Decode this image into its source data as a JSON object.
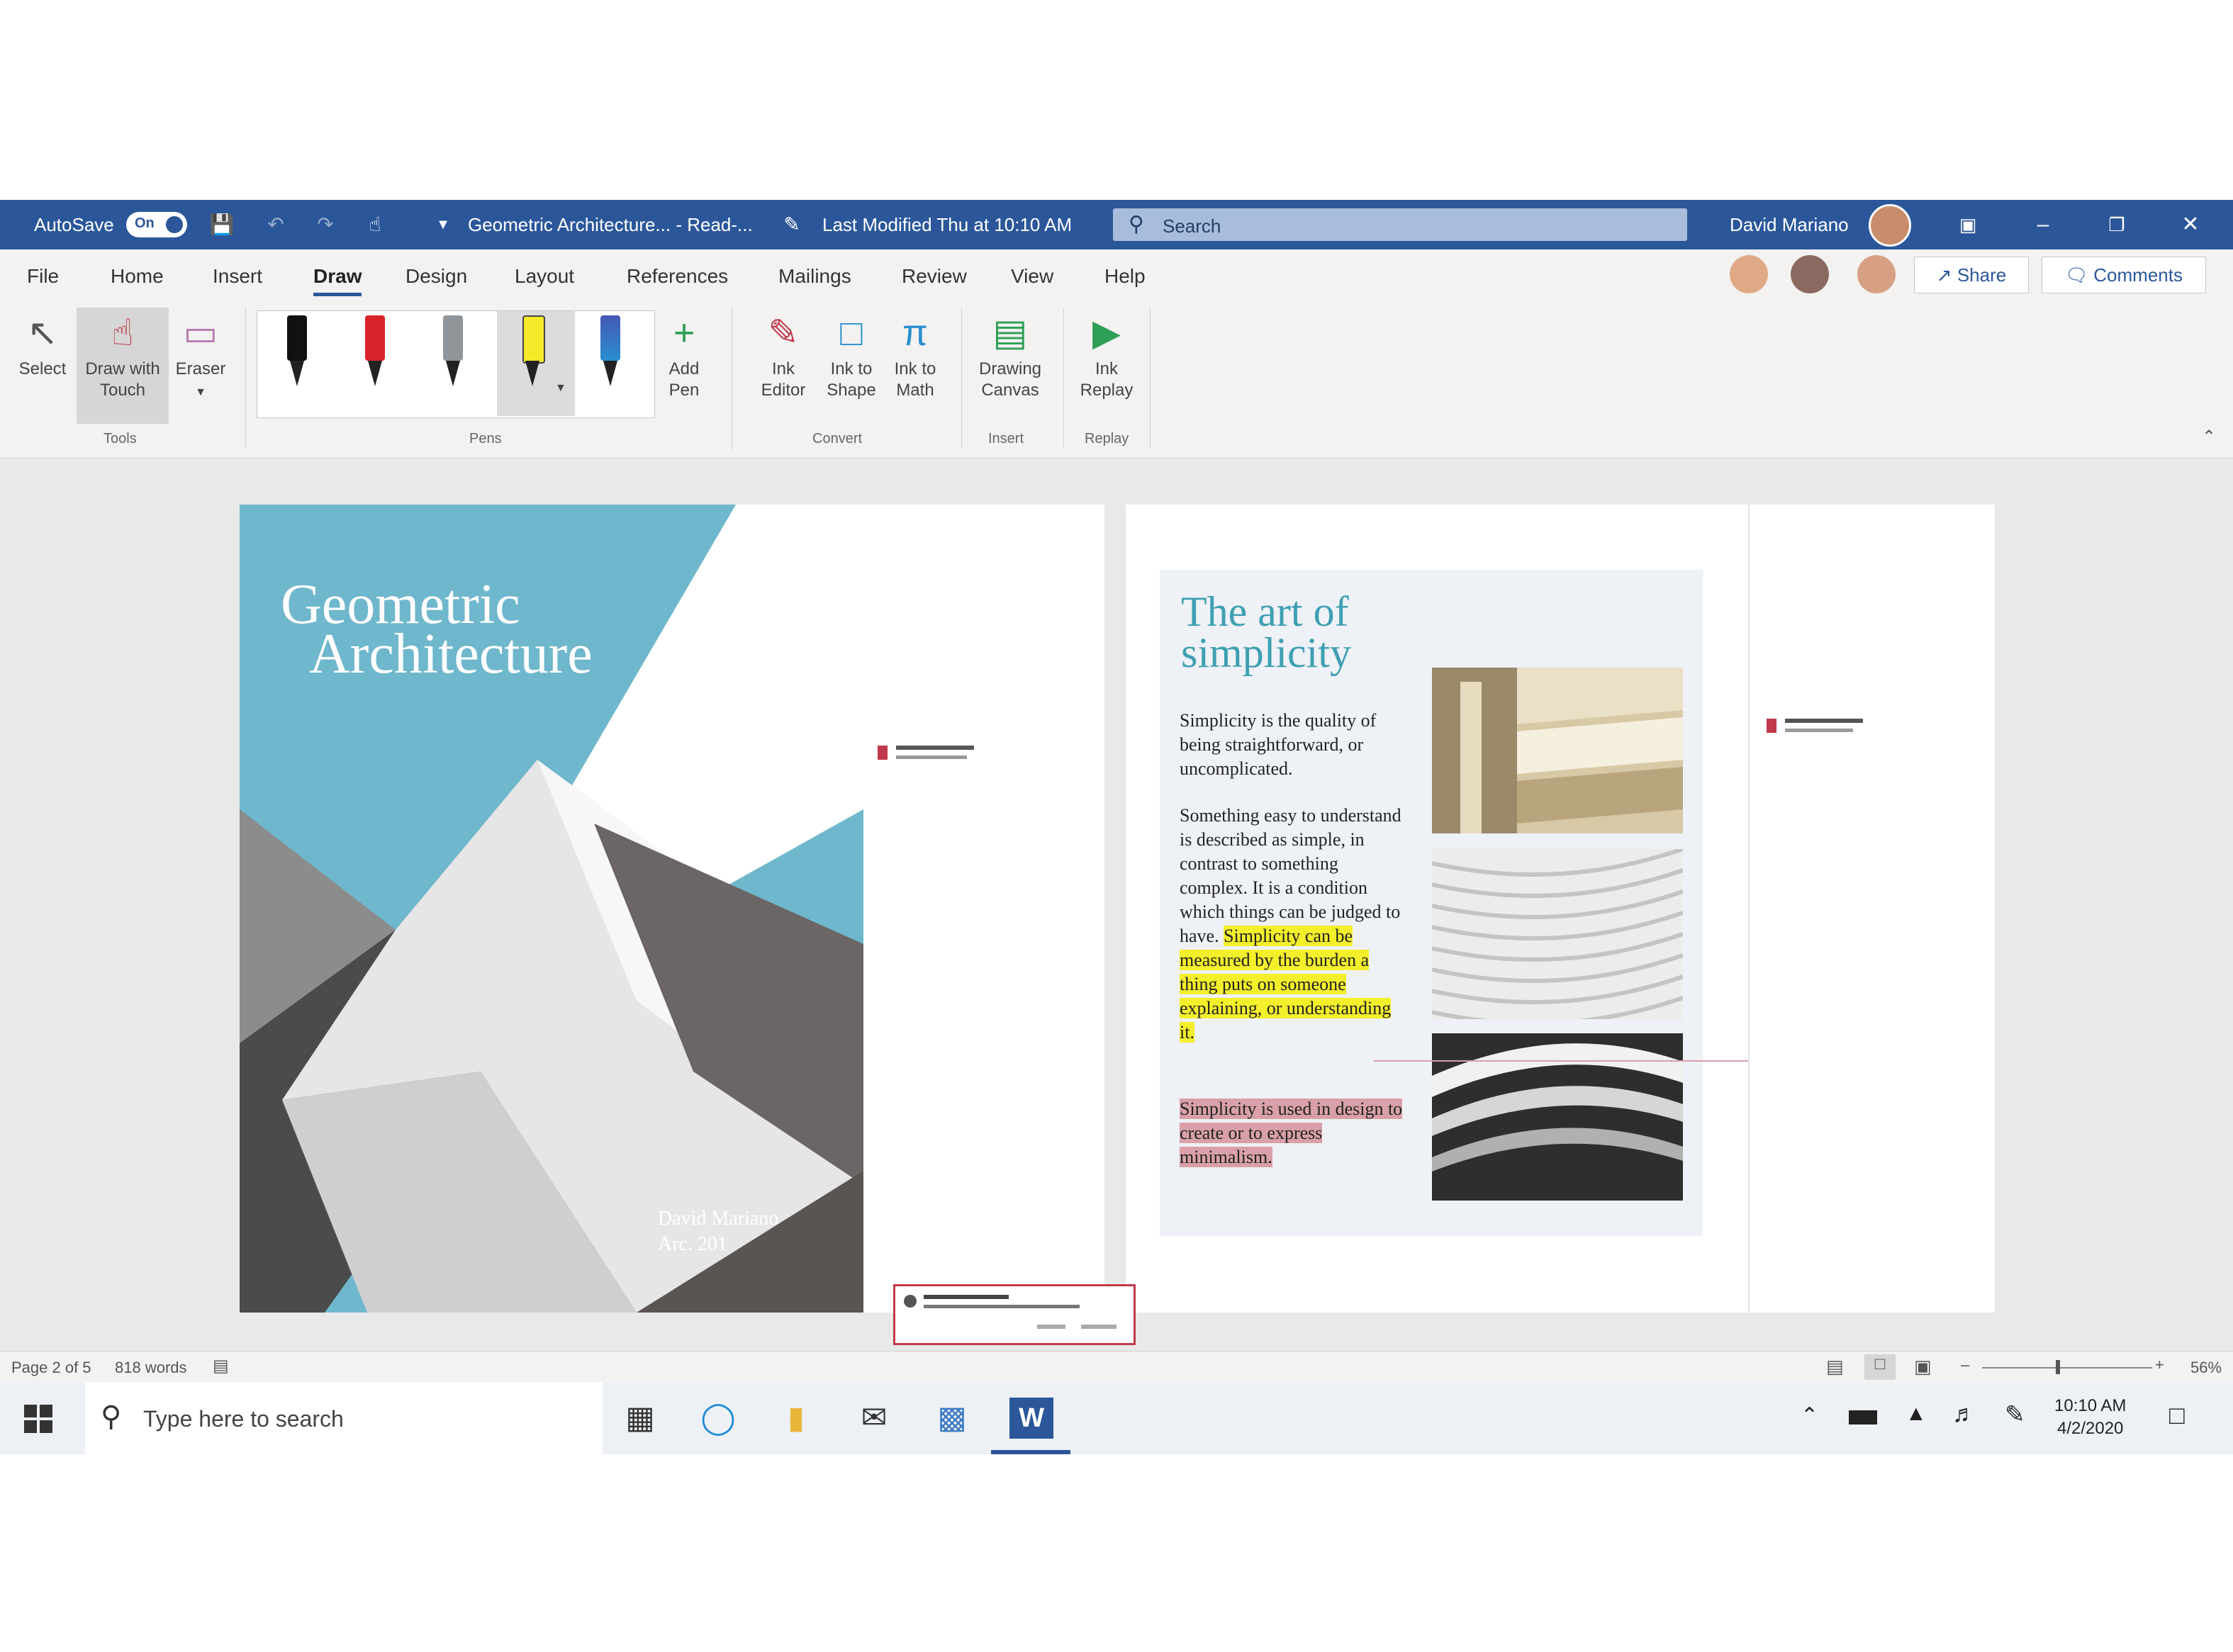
{
  "window": {
    "autosave_label": "AutoSave",
    "autosave_state": "On",
    "document_title": "Geometric Architecture... - Read-...",
    "last_modified": "Last Modified Thu at 10:10 AM",
    "search_placeholder": "Search",
    "user_name": "David Mariano"
  },
  "tabs": [
    "File",
    "Home",
    "Insert",
    "Draw",
    "Design",
    "Layout",
    "References",
    "Mailings",
    "Review",
    "View",
    "Help"
  ],
  "active_tab": "Draw",
  "share_label": "Share",
  "comments_label": "Comments",
  "ribbon": {
    "tools": {
      "select": "Select",
      "draw_with_touch_1": "Draw with",
      "draw_with_touch_2": "Touch",
      "eraser": "Eraser",
      "group": "Tools"
    },
    "pens": {
      "add_pen_1": "Add",
      "add_pen_2": "Pen",
      "group": "Pens"
    },
    "convert": {
      "ink_editor_1": "Ink",
      "ink_editor_2": "Editor",
      "ink_to_shape_1": "Ink to",
      "ink_to_shape_2": "Shape",
      "ink_to_math_1": "Ink to",
      "ink_to_math_2": "Math",
      "group": "Convert"
    },
    "insert": {
      "drawing_canvas_1": "Drawing",
      "drawing_canvas_2": "Canvas",
      "group": "Insert"
    },
    "replay": {
      "ink_replay_1": "Ink",
      "ink_replay_2": "Replay",
      "group": "Replay"
    }
  },
  "document": {
    "cover_title_1": "Geometric",
    "cover_title_2": "Architecture",
    "cover_author_1": "David Mariano",
    "cover_author_2": "Arc. 201",
    "article_title_1": "The art of",
    "article_title_2": "simplicity",
    "para1": "Simplicity is the quality of being straightforward, or uncomplicated.",
    "para2_plain": "Something easy to understand is described as simple, in contrast to something complex. It is a condition which things can be judged to have.",
    "para2_highlight": "Simplicity can be measured by the burden a thing puts on someone explaining, or understanding it.",
    "para3_highlight": "Simplicity is used in design to create or to express minimalism."
  },
  "status": {
    "page": "Page 2 of 5",
    "words": "818 words",
    "zoom": "56%"
  },
  "taskbar": {
    "search_placeholder": "Type here to search",
    "time": "10:10 AM",
    "date": "4/2/2020"
  },
  "colors": {
    "title_bar": "#2b579a",
    "cover_sky": "#6fb7cc",
    "highlight_yellow": "#f3ef2b",
    "highlight_pink": "#d9a0a7",
    "article_title": "#3e9fb2"
  }
}
